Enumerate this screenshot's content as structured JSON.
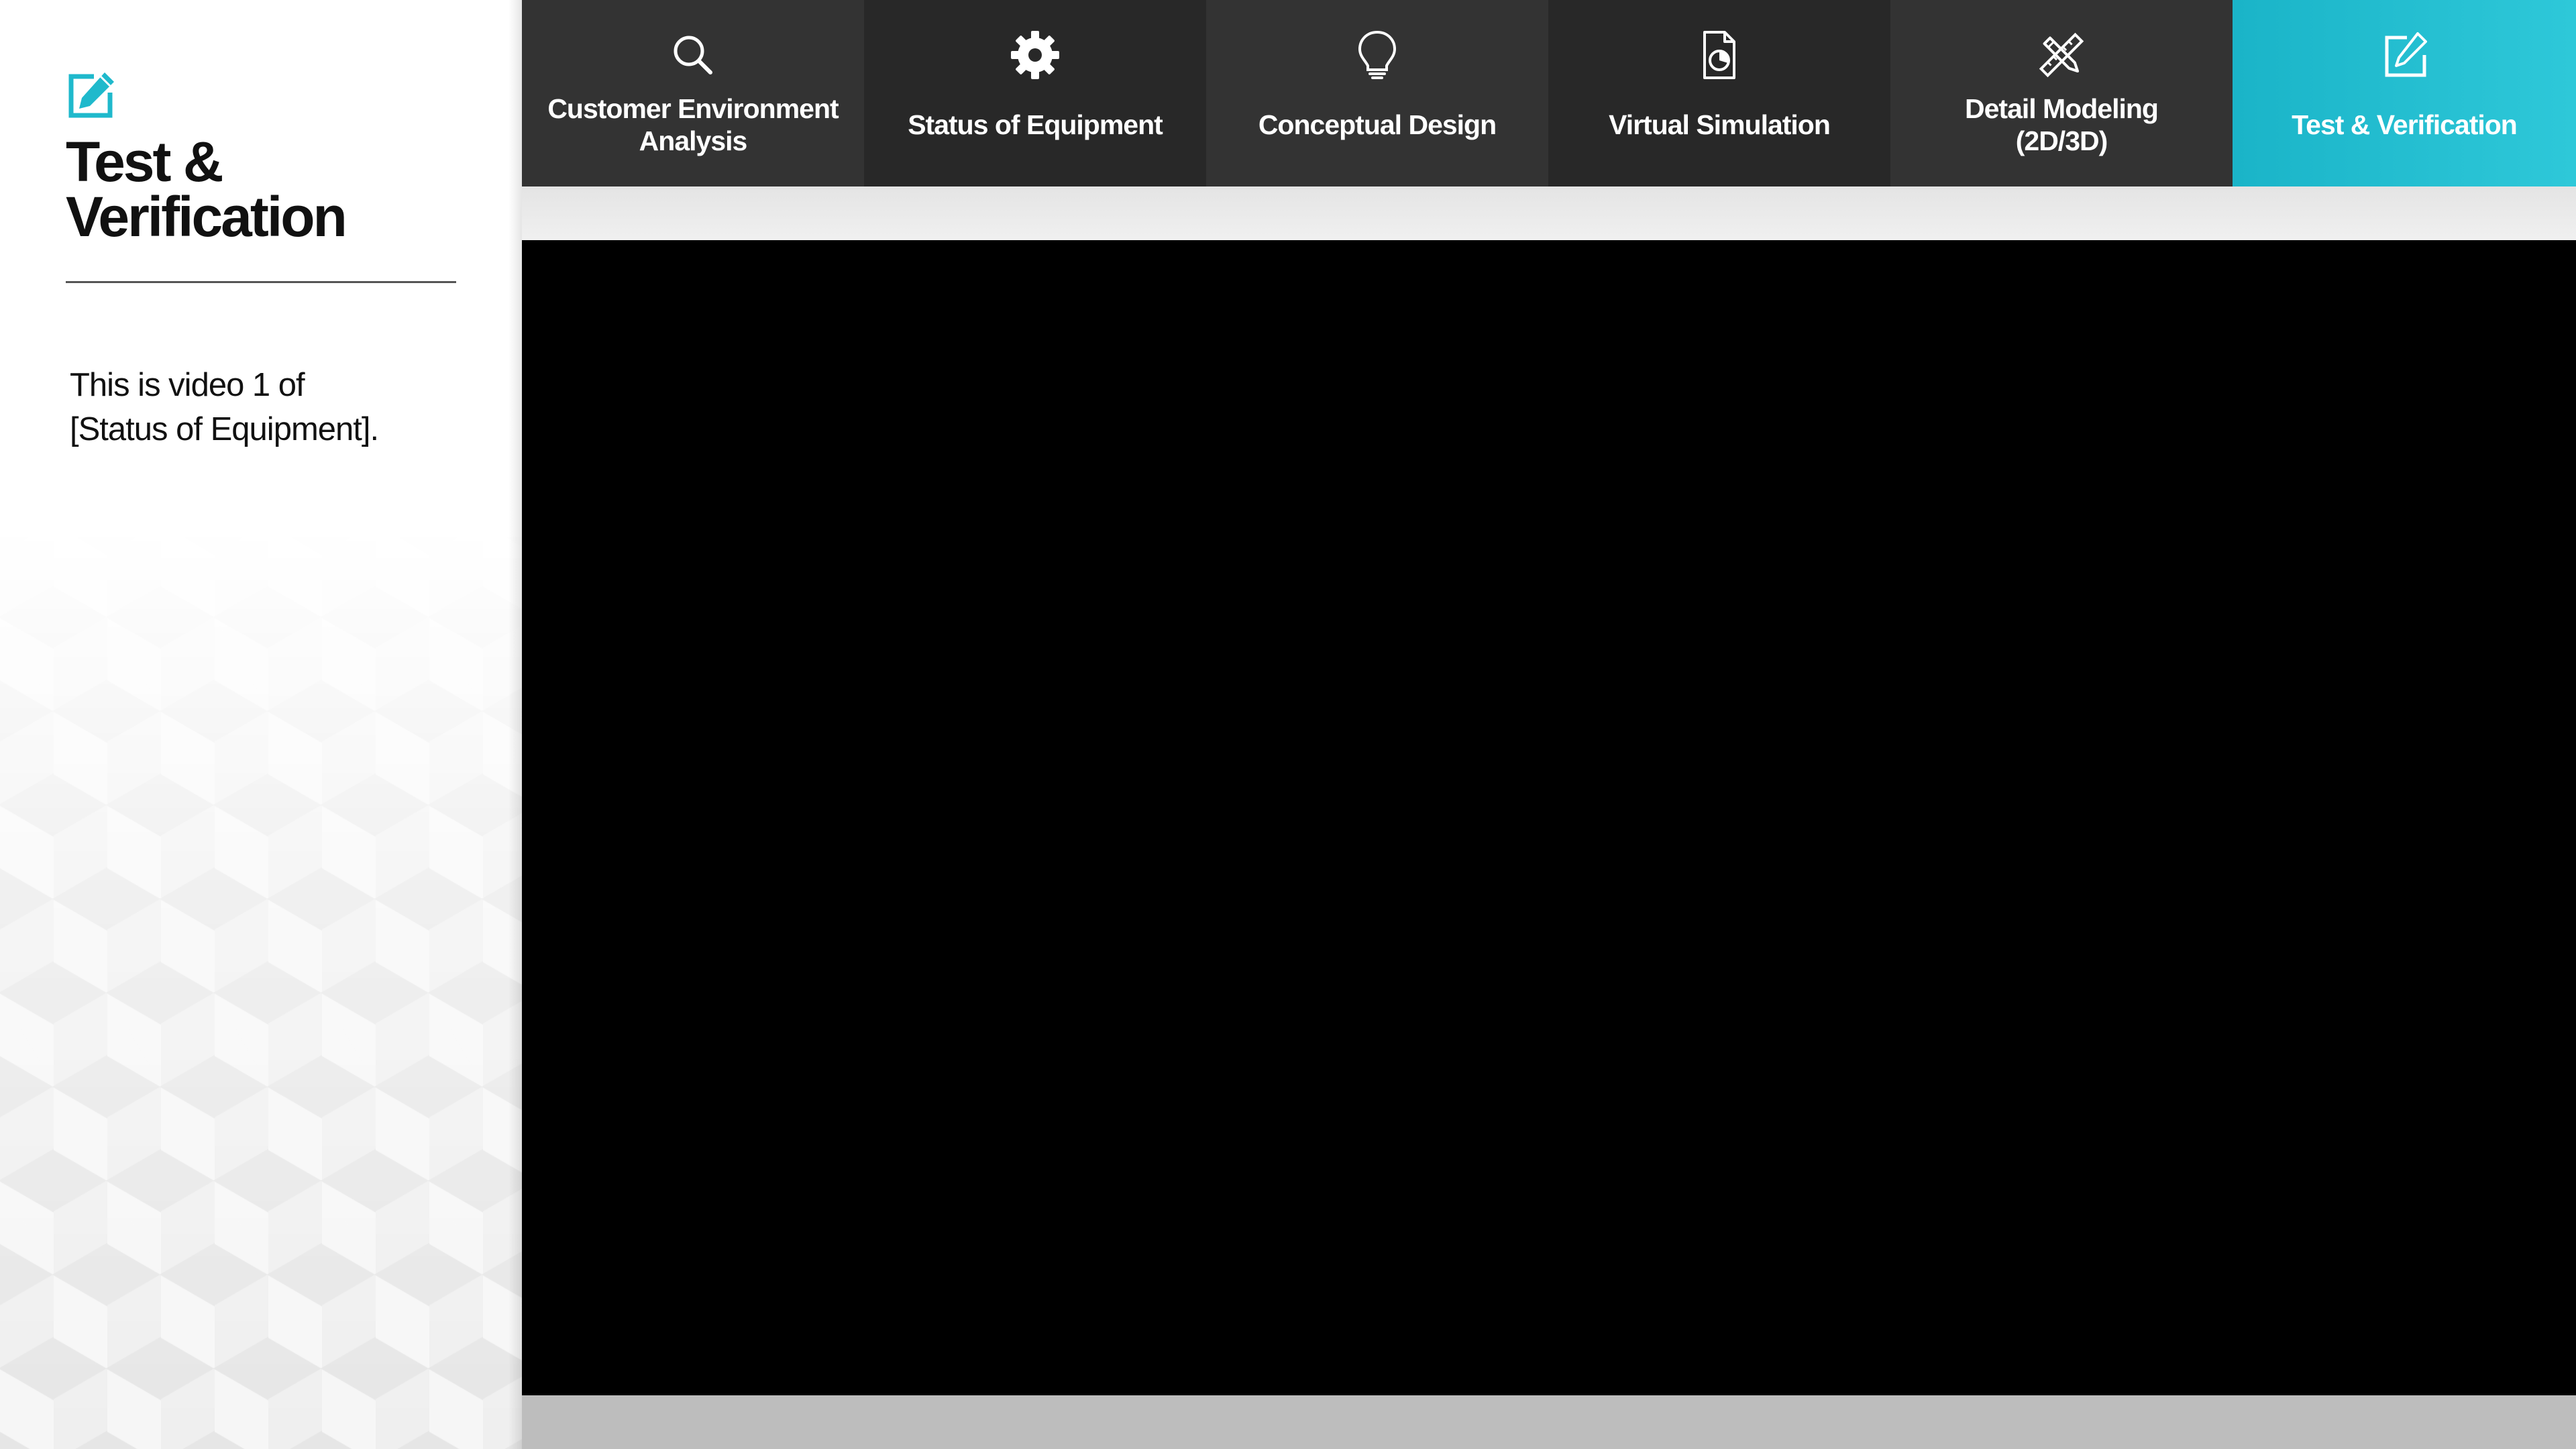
{
  "colors": {
    "accent": "#1fb9cc",
    "accent_light": "#2ec8d9",
    "tab_dark_a": "#333333",
    "tab_dark_b": "#282828",
    "player_bg": "#000000"
  },
  "sidebar": {
    "icon": "edit-square-icon",
    "title": "Test &\nVerification",
    "description": "This is video 1 of\n[Status of Equipment]."
  },
  "nav": {
    "tabs": [
      {
        "label": "Customer Environment\nAnalysis",
        "icon": "search-icon",
        "active": false
      },
      {
        "label": "Status of Equipment",
        "icon": "gear-icon",
        "active": false
      },
      {
        "label": "Conceptual Design",
        "icon": "lightbulb-icon",
        "active": false
      },
      {
        "label": "Virtual Simulation",
        "icon": "document-chart-icon",
        "active": false
      },
      {
        "label": "Detail Modeling\n(2D/3D)",
        "icon": "pencil-ruler-icon",
        "active": false
      },
      {
        "label": "Test & Verification",
        "icon": "edit-square-icon",
        "active": true
      }
    ]
  }
}
